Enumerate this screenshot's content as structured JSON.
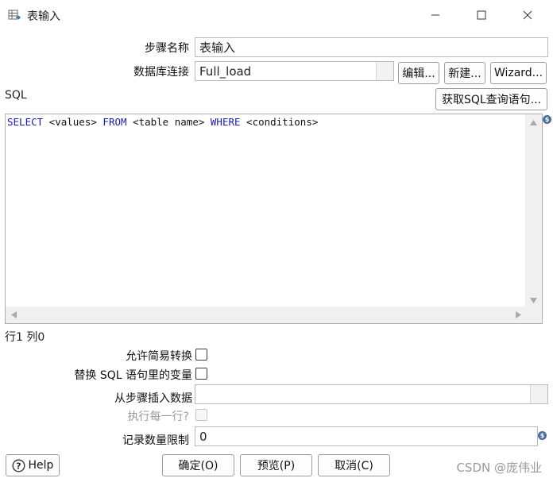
{
  "window": {
    "title": "表输入",
    "icon": "table-input-icon",
    "controls": [
      "minimize-icon",
      "maximize-icon",
      "close-icon"
    ]
  },
  "form": {
    "step_name_label": "步骤名称",
    "step_name_value": "表输入",
    "db_connection_label": "数据库连接",
    "db_connection_value": "Full_load",
    "edit_button": "编辑...",
    "new_button": "新建...",
    "wizard_button": "Wizard...",
    "sql_label": "SQL",
    "get_sql_button": "获取SQL查询语句..."
  },
  "editor": {
    "tokens": [
      {
        "text": "SELECT",
        "kw": true
      },
      {
        "text": " <values> ",
        "kw": false
      },
      {
        "text": "FROM",
        "kw": true
      },
      {
        "text": " <table name> ",
        "kw": false
      },
      {
        "text": "WHERE",
        "kw": true
      },
      {
        "text": " <conditions>",
        "kw": false
      }
    ],
    "cursor_position": "行1 列0"
  },
  "options": {
    "lazy_conversion_label": "允许简易转换",
    "lazy_conversion_checked": false,
    "replace_variables_label": "替换 SQL 语句里的变量",
    "replace_variables_checked": false,
    "insert_from_step_label": "从步骤插入数据",
    "insert_from_step_value": "",
    "execute_each_row_label": "执行每一行?",
    "execute_each_row_enabled": false,
    "limit_label": "记录数量限制",
    "limit_value": "0"
  },
  "footer": {
    "help_button": "Help",
    "ok_button": "确定(O)",
    "preview_button": "预览(P)",
    "cancel_button": "取消(C)"
  },
  "watermark": "CSDN @庞伟业",
  "colors": {
    "keyword": "#1b1bb0",
    "disabled_text": "#9a9a9a",
    "variable_icon": "#4a6f9a"
  }
}
